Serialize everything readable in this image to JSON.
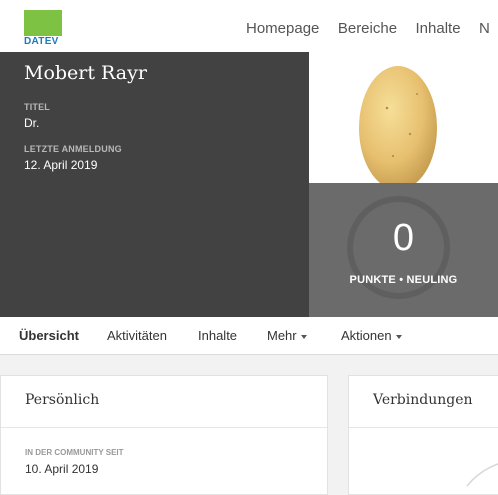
{
  "brand": {
    "logo_text": "DATEV",
    "accent_green": "#7dc242",
    "accent_blue": "#1a7bbd"
  },
  "nav": {
    "items": [
      "Homepage",
      "Bereiche",
      "Inhalte",
      "N"
    ]
  },
  "profile": {
    "name": "Mobert Rayr",
    "title_label": "TITEL",
    "title_value": "Dr.",
    "last_login_label": "LETZTE ANMELDUNG",
    "last_login_value": "12. April 2019",
    "avatar_icon": "potato-avatar"
  },
  "points": {
    "value": "0",
    "label": "PUNKTE • NEULING"
  },
  "tabs": {
    "overview": "Übersicht",
    "activities": "Aktivitäten",
    "content": "Inhalte",
    "more": "Mehr",
    "actions": "Aktionen"
  },
  "cards": {
    "personal": {
      "title": "Persönlich",
      "member_since_label": "IN DER COMMUNITY SEIT",
      "member_since_value": "10. April 2019"
    },
    "connections": {
      "title": "Verbindungen"
    }
  }
}
